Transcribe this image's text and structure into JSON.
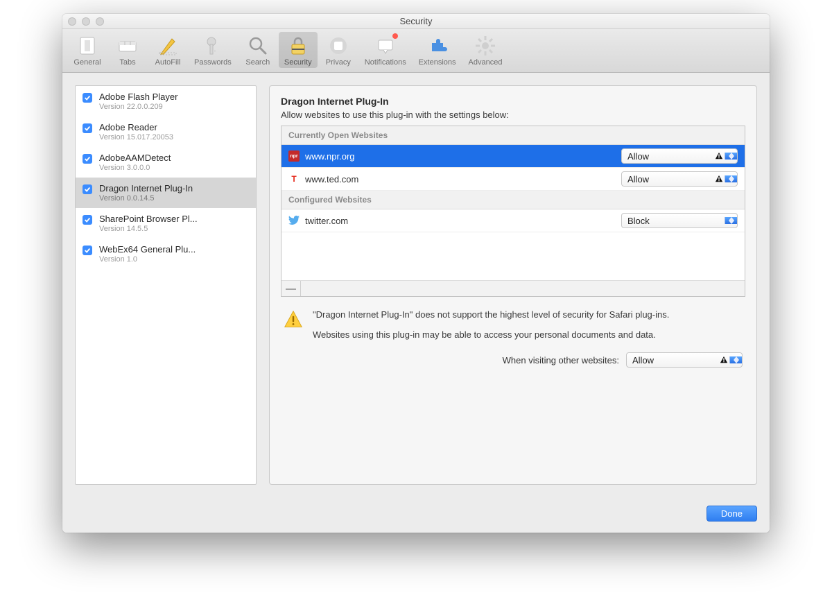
{
  "window": {
    "title": "Security"
  },
  "toolbar": [
    {
      "key": "general",
      "label": "General"
    },
    {
      "key": "tabs",
      "label": "Tabs"
    },
    {
      "key": "autofill",
      "label": "AutoFill"
    },
    {
      "key": "passwords",
      "label": "Passwords"
    },
    {
      "key": "search",
      "label": "Search"
    },
    {
      "key": "security",
      "label": "Security",
      "selected": true
    },
    {
      "key": "privacy",
      "label": "Privacy"
    },
    {
      "key": "notifications",
      "label": "Notifications",
      "badge": true
    },
    {
      "key": "extensions",
      "label": "Extensions"
    },
    {
      "key": "advanced",
      "label": "Advanced"
    }
  ],
  "sidebar": {
    "plugins": [
      {
        "name": "Adobe Flash Player",
        "version": "Version 22.0.0.209",
        "checked": true
      },
      {
        "name": "Adobe Reader",
        "version": "Version 15.017.20053",
        "checked": true
      },
      {
        "name": "AdobeAAMDetect",
        "version": "Version 3.0.0.0",
        "checked": true
      },
      {
        "name": "Dragon Internet Plug-In",
        "version": "Version 0.0.14.5",
        "checked": true,
        "selected": true
      },
      {
        "name": "SharePoint Browser Pl...",
        "version": "Version 14.5.5",
        "checked": true
      },
      {
        "name": "WebEx64 General Plu...",
        "version": "Version 1.0",
        "checked": true
      }
    ]
  },
  "main": {
    "title": "Dragon Internet Plug-In",
    "subtitle": "Allow websites to use this plug-in with the settings below:",
    "sections": {
      "open_label": "Currently Open Websites",
      "configured_label": "Configured Websites"
    },
    "open_sites": [
      {
        "domain": "www.npr.org",
        "setting": "Allow",
        "warn": true,
        "selected": true,
        "favText": "npr",
        "favBg": "#c42a2a",
        "favColor": "#fff"
      },
      {
        "domain": "www.ted.com",
        "setting": "Allow",
        "warn": true,
        "favText": "T",
        "favBg": "#ffffff",
        "favColor": "#e62b1e"
      }
    ],
    "configured_sites": [
      {
        "domain": "twitter.com",
        "setting": "Block",
        "warn": false,
        "favText": "",
        "favBg": "transparent"
      }
    ],
    "remove_button_label": "—",
    "warning": {
      "line1": "\"Dragon Internet Plug-In\" does not support the highest level of security for Safari plug-ins.",
      "line2": "Websites using this plug-in may be able to access your personal documents and data."
    },
    "other_sites_label": "When visiting other websites:",
    "other_sites_setting": "Allow",
    "other_sites_warn": true
  },
  "footer": {
    "done_label": "Done"
  }
}
